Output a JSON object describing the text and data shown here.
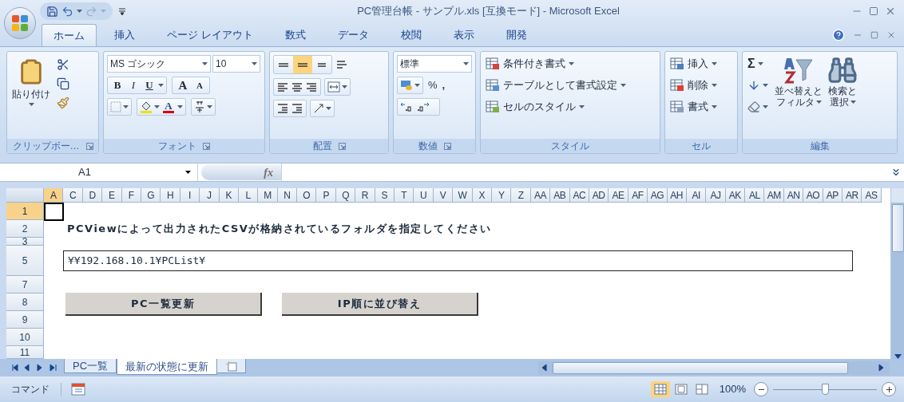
{
  "window": {
    "title": "PC管理台帳 - サンプル.xls  [互換モード] - Microsoft Excel"
  },
  "ribbon_tabs": [
    {
      "label": "ホーム",
      "selected": true
    },
    {
      "label": "挿入",
      "selected": false
    },
    {
      "label": "ページ レイアウト",
      "selected": false
    },
    {
      "label": "数式",
      "selected": false
    },
    {
      "label": "データ",
      "selected": false
    },
    {
      "label": "校閲",
      "selected": false
    },
    {
      "label": "表示",
      "selected": false
    },
    {
      "label": "開発",
      "selected": false
    }
  ],
  "ribbon": {
    "clipboard": {
      "paste": "貼り付け",
      "label": "クリップボー…"
    },
    "font": {
      "name": "MS ゴシック",
      "size": "10",
      "bold": "B",
      "italic": "I",
      "underline": "U",
      "grow": "A",
      "shrink": "A",
      "font_color_label": "A",
      "label": "フォント"
    },
    "alignment": {
      "vertical": [
        {
          "selected": false
        },
        {
          "selected": true
        },
        {
          "selected": false
        }
      ],
      "label": "配置"
    },
    "number": {
      "format": "標準",
      "percent": "%",
      "comma": ",",
      "label": "数値"
    },
    "styles": {
      "items": [
        "条件付き書式",
        "テーブルとして書式設定",
        "セルのスタイル"
      ],
      "label": "スタイル"
    },
    "cells": {
      "items": [
        "挿入",
        "削除",
        "書式"
      ],
      "label": "セル"
    },
    "editing": {
      "sum": "Σ",
      "sort": [
        "並べ替えと",
        "フィルタ"
      ],
      "find": [
        "検索と",
        "選択"
      ],
      "label": "編集"
    }
  },
  "formula_bar": {
    "name_box": "A1",
    "function_label": "fx"
  },
  "columns": [
    {
      "label": "A",
      "selected": true
    },
    {
      "label": "C",
      "selected": false
    },
    {
      "label": "D",
      "selected": false
    },
    {
      "label": "E",
      "selected": false
    },
    {
      "label": "F",
      "selected": false
    },
    {
      "label": "G",
      "selected": false
    },
    {
      "label": "H",
      "selected": false
    },
    {
      "label": "I",
      "selected": false
    },
    {
      "label": "J",
      "selected": false
    },
    {
      "label": "K",
      "selected": false
    },
    {
      "label": "L",
      "selected": false
    },
    {
      "label": "M",
      "selected": false
    },
    {
      "label": "N",
      "selected": false
    },
    {
      "label": "O",
      "selected": false
    },
    {
      "label": "P",
      "selected": false
    },
    {
      "label": "Q",
      "selected": false
    },
    {
      "label": "R",
      "selected": false
    },
    {
      "label": "S",
      "selected": false
    },
    {
      "label": "T",
      "selected": false
    },
    {
      "label": "U",
      "selected": false
    },
    {
      "label": "V",
      "selected": false
    },
    {
      "label": "W",
      "selected": false
    },
    {
      "label": "X",
      "selected": false
    },
    {
      "label": "Y",
      "selected": false
    },
    {
      "label": "Z",
      "selected": false
    },
    {
      "label": "AA",
      "selected": false
    },
    {
      "label": "AB",
      "selected": false
    },
    {
      "label": "AC",
      "selected": false
    },
    {
      "label": "AD",
      "selected": false
    },
    {
      "label": "AE",
      "selected": false
    },
    {
      "label": "AF",
      "selected": false
    },
    {
      "label": "AG",
      "selected": false
    },
    {
      "label": "AH",
      "selected": false
    },
    {
      "label": "AI",
      "selected": false
    },
    {
      "label": "AJ",
      "selected": false
    },
    {
      "label": "AK",
      "selected": false
    },
    {
      "label": "AL",
      "selected": false
    },
    {
      "label": "AM",
      "selected": false
    },
    {
      "label": "AN",
      "selected": false
    },
    {
      "label": "AO",
      "selected": false
    },
    {
      "label": "AP",
      "selected": false
    },
    {
      "label": "AR",
      "selected": false
    },
    {
      "label": "AS",
      "selected": false
    }
  ],
  "rows": [
    {
      "label": "1",
      "selected": true
    },
    {
      "label": "2",
      "selected": false
    },
    {
      "label": "3",
      "selected": false
    },
    {
      "label": "5",
      "selected": false
    },
    {
      "label": "7",
      "selected": false
    },
    {
      "label": "8",
      "selected": false
    },
    {
      "label": "9",
      "selected": false
    },
    {
      "label": "10",
      "selected": false
    },
    {
      "label": "11",
      "selected": false
    }
  ],
  "sheet": {
    "instruction": "PCViewによって出力されたCSVが格納されているフォルダを指定してください",
    "folder_path": "¥¥192.168.10.1¥PCList¥",
    "buttons": [
      "PC一覧更新",
      "IP順に並び替え"
    ]
  },
  "sheet_tabs": [
    {
      "label": "PC一覧",
      "selected": false
    },
    {
      "label": "最新の状態に更新",
      "selected": true
    }
  ],
  "status_bar": {
    "mode": "コマンド",
    "views": [
      {
        "selected": true
      },
      {
        "selected": false
      },
      {
        "selected": false
      }
    ],
    "zoom": "100%",
    "zoom_slider": {
      "level": 0.5
    }
  }
}
